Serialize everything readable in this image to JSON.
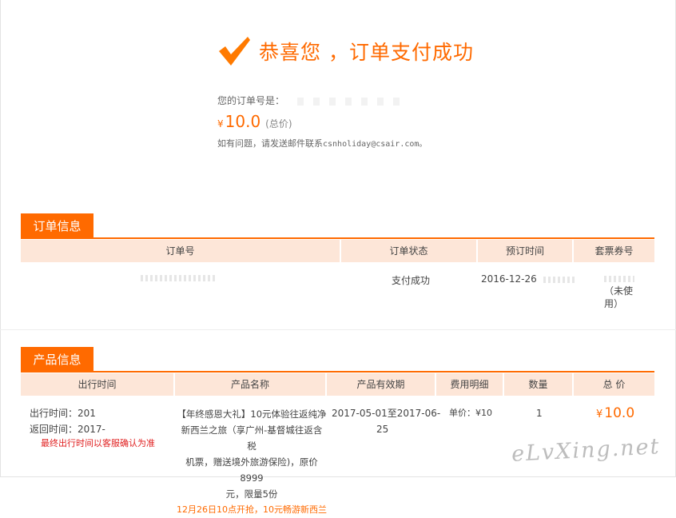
{
  "success": {
    "title": "恭喜您 ，订单支付成功",
    "order_label": "您的订单号是：",
    "price_currency": "¥",
    "price_value": "10.0",
    "price_note": "(总价)",
    "help_text": "如有问题，请发送邮件联系",
    "help_email": "csnholiday@csair.com。"
  },
  "order_section": {
    "tab": "订单信息",
    "columns": [
      "订单号",
      "订单状态",
      "预订时间",
      "套票券号"
    ],
    "row": {
      "status": "支付成功",
      "booked_time": "2016-12-26",
      "voucher_note": "（未使",
      "voucher_note2": "用）"
    }
  },
  "product_section": {
    "tab": "产品信息",
    "columns": [
      "出行时间",
      "产品名称",
      "产品有效期",
      "费用明细",
      "数量",
      "总 价"
    ],
    "row": {
      "depart_label": "出行时间：",
      "depart_value": "201",
      "return_label": "返回时间：",
      "return_value": "2017-",
      "final_note": "最终出行时间以客服确认为准",
      "name_lines": [
        "【年终感恩大礼】10元体验往返纯净",
        "新西兰之旅（享广州-基督城往返含税",
        "机票，赠送境外旅游保险)，原价8999",
        "元，限量5份"
      ],
      "name_extra": "12月26日10点开抢，10元畅游新西兰",
      "validity_line1": "2017-05-01至2017-06-",
      "validity_line2": "25",
      "fee": "单价：¥10",
      "quantity": "1",
      "total_currency": "¥",
      "total_value": "10.0"
    }
  },
  "watermark": "eLvXing.net",
  "colors": {
    "accent": "#ff6a00",
    "header_bg": "#fde6d8",
    "note_red": "#e02020"
  },
  "icons": {
    "success": "checkmark-icon"
  }
}
